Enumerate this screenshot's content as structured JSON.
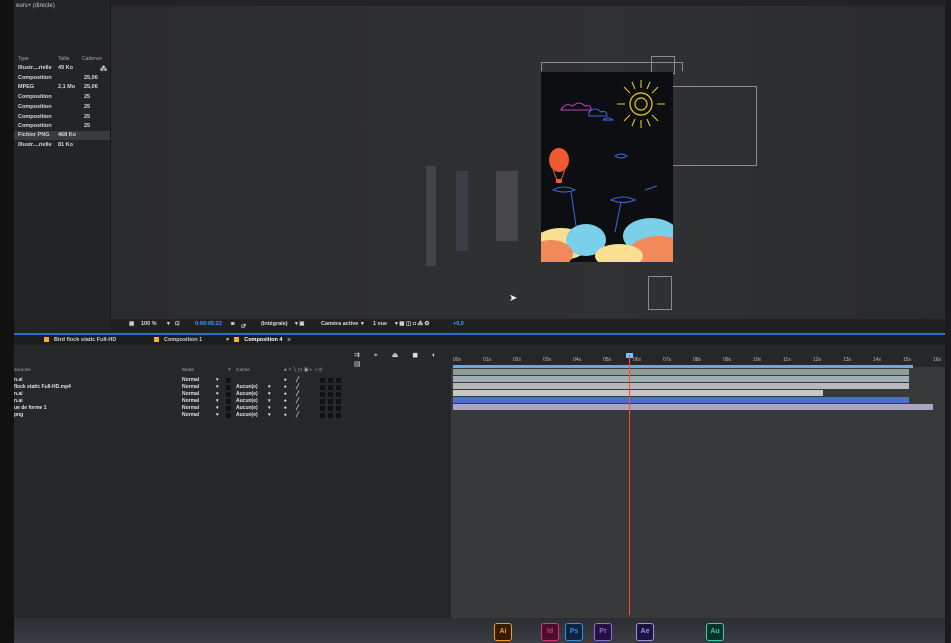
{
  "project_panel": {
    "title": "eurs+ (directe)",
    "columns": {
      "type": "Type",
      "size": "Taille",
      "rate": "Cadence"
    },
    "rows": [
      {
        "type": "Illustr....rielle",
        "size": "49 Ko",
        "rate": ""
      },
      {
        "type": "Composition",
        "size": "",
        "rate": "25,06"
      },
      {
        "type": "MPEG",
        "size": "2,1 Mo",
        "rate": "25,06"
      },
      {
        "type": "Composition",
        "size": "",
        "rate": "25"
      },
      {
        "type": "Composition",
        "size": "",
        "rate": "25"
      },
      {
        "type": "Composition",
        "size": "",
        "rate": "25"
      },
      {
        "type": "Composition",
        "size": "",
        "rate": "25"
      },
      {
        "type": "Fichier PNG",
        "size": "468 Ko",
        "rate": ""
      },
      {
        "type": "Illustr....rielle",
        "size": "81 Ko",
        "rate": ""
      }
    ]
  },
  "viewer_toolbar": {
    "zoom": "100 %",
    "timecode": "0:00:05:22",
    "resolution": "(Intégrale)",
    "camera": "Caméra active",
    "views": "1 vue",
    "exposure": "+0,0"
  },
  "timeline_tabs": [
    {
      "label": "Bird flock static Full-HD",
      "active": false
    },
    {
      "label": "Composition 1",
      "active": false
    },
    {
      "label": "Composition 4",
      "active": true
    }
  ],
  "timeline_header": {
    "source": "sources",
    "mode": "Mode",
    "t": "T",
    "matte": "Cache"
  },
  "layers": [
    {
      "name": "n.ai",
      "mode": "Normal",
      "matte": ""
    },
    {
      "name": "flock static Full-HD.mp4",
      "mode": "Normal",
      "matte": "Aucun(e)"
    },
    {
      "name": "n.ai",
      "mode": "Normal",
      "matte": "Aucun(e)"
    },
    {
      "name": "n.ai",
      "mode": "Normal",
      "matte": "Aucun(e)"
    },
    {
      "name": "ue de forme 1",
      "mode": "Normal",
      "matte": "Aucun(e)"
    },
    {
      "name": "png",
      "mode": "Normal",
      "matte": "Aucun(e)"
    }
  ],
  "ruler_ticks": [
    "00s",
    "01s",
    "02s",
    "03s",
    "04s",
    "05s",
    "06s",
    "07s",
    "08s",
    "09s",
    "10s",
    "11s",
    "12s",
    "13s",
    "14s",
    "15s",
    "16s"
  ],
  "dock_apps": [
    "Ai",
    "Id",
    "Ps",
    "Pr",
    "Ae",
    "Au"
  ],
  "colors": {
    "accent": "#2b6fd6",
    "playhead": "#ff4a2a",
    "comp_tab": "#f0b020"
  }
}
